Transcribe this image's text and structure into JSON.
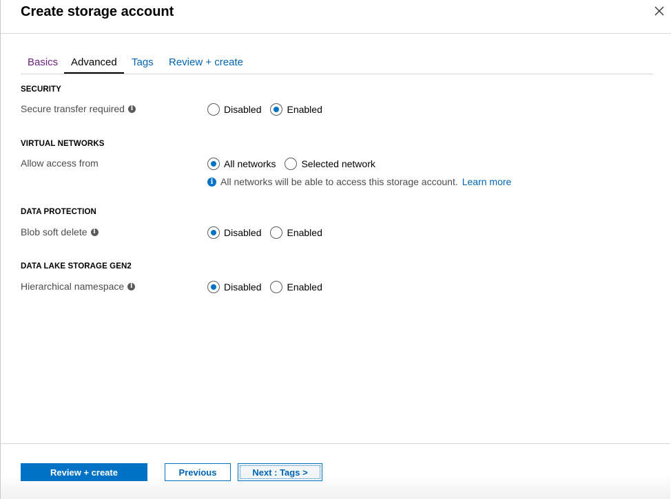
{
  "header": {
    "title": "Create storage account"
  },
  "tabs": [
    {
      "label": "Basics",
      "state": "visited"
    },
    {
      "label": "Advanced",
      "state": "active"
    },
    {
      "label": "Tags",
      "state": "default"
    },
    {
      "label": "Review + create",
      "state": "default"
    }
  ],
  "security": {
    "heading": "SECURITY",
    "secure_transfer": {
      "label": "Secure transfer required",
      "options": [
        "Disabled",
        "Enabled"
      ],
      "selected": "Enabled"
    }
  },
  "virtual_networks": {
    "heading": "VIRTUAL NETWORKS",
    "allow_access": {
      "label": "Allow access from",
      "options": [
        "All networks",
        "Selected network"
      ],
      "selected": "All networks"
    },
    "info_text": "All networks will be able to access this storage account.",
    "info_link": "Learn more"
  },
  "data_protection": {
    "heading": "DATA PROTECTION",
    "blob_soft_delete": {
      "label": "Blob soft delete",
      "options": [
        "Disabled",
        "Enabled"
      ],
      "selected": "Disabled"
    }
  },
  "data_lake": {
    "heading": "DATA LAKE STORAGE GEN2",
    "hierarchical_namespace": {
      "label": "Hierarchical namespace",
      "options": [
        "Disabled",
        "Enabled"
      ],
      "selected": "Disabled"
    }
  },
  "footer": {
    "review_create": "Review + create",
    "previous": "Previous",
    "next": "Next : Tags >"
  },
  "colors": {
    "accent": "#0072c6",
    "link": "#0063b1",
    "visited": "#68217a"
  },
  "icons": {
    "close": "close-icon",
    "info": "info-icon"
  }
}
